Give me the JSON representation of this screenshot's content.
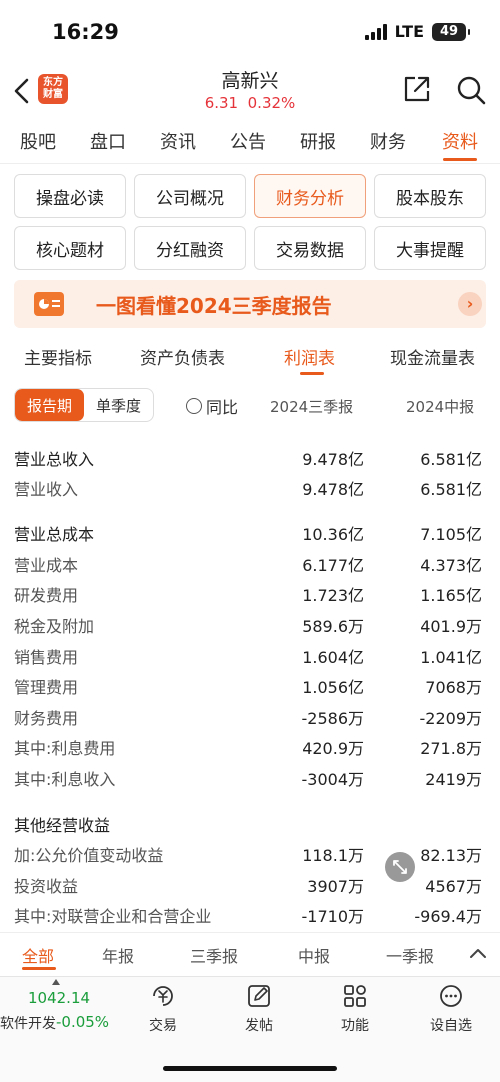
{
  "status": {
    "time": "16:29",
    "network": "LTE",
    "battery": "49"
  },
  "nav": {
    "logo_text": "东方财富",
    "stock_name": "高新兴",
    "price": "6.31",
    "change_pct": "0.32%"
  },
  "main_tabs": [
    "股吧",
    "盘口",
    "资讯",
    "公告",
    "研报",
    "财务",
    "资料"
  ],
  "main_tab_active": "资料",
  "grid_buttons": [
    "操盘必读",
    "公司概况",
    "财务分析",
    "股本股东",
    "核心题材",
    "分红融资",
    "交易数据",
    "大事提醒"
  ],
  "grid_active": "财务分析",
  "banner": {
    "text": "一图看懂2024三季度报告",
    "arrow": "›"
  },
  "sub_tabs": [
    "主要指标",
    "资产负债表",
    "利润表",
    "现金流量表"
  ],
  "sub_tab_active": "利润表",
  "controls": {
    "toggle_report": "报告期",
    "toggle_quarter": "单季度",
    "yoy": "同比",
    "col1": "2024三季报",
    "col2": "2024中报"
  },
  "rows": [
    {
      "label": "营业总收入",
      "v1": "9.478亿",
      "v2": "6.581亿",
      "section": true
    },
    {
      "label": "营业收入",
      "v1": "9.478亿",
      "v2": "6.581亿"
    },
    {
      "label": "营业总成本",
      "v1": "10.36亿",
      "v2": "7.105亿",
      "section": true
    },
    {
      "label": "营业成本",
      "v1": "6.177亿",
      "v2": "4.373亿"
    },
    {
      "label": "研发费用",
      "v1": "1.723亿",
      "v2": "1.165亿"
    },
    {
      "label": "税金及附加",
      "v1": "589.6万",
      "v2": "401.9万"
    },
    {
      "label": "销售费用",
      "v1": "1.604亿",
      "v2": "1.041亿"
    },
    {
      "label": "管理费用",
      "v1": "1.056亿",
      "v2": "7068万"
    },
    {
      "label": "财务费用",
      "v1": "-2586万",
      "v2": "-2209万"
    },
    {
      "label": "其中:利息费用",
      "v1": "420.9万",
      "v2": "271.8万"
    },
    {
      "label": "其中:利息收入",
      "v1": "-3004万",
      "v2": "2419万"
    },
    {
      "label": "其他经营收益",
      "v1": "",
      "v2": "",
      "section": true
    },
    {
      "label": "加:公允价值变动收益",
      "v1": "118.1万",
      "v2": "82.13万"
    },
    {
      "label": "投资收益",
      "v1": "3907万",
      "v2": "4567万"
    },
    {
      "label": "其中:对联营企业和合营企业",
      "v1": "-1710万",
      "v2": "-969.4万"
    }
  ],
  "filter_bar": [
    "全部",
    "年报",
    "三季报",
    "中报",
    "一季报"
  ],
  "filter_active": "全部",
  "bottom": {
    "index_value": "1042.14",
    "index_name": "软件开发",
    "index_change": "-0.05%",
    "items": [
      "交易",
      "发帖",
      "功能",
      "设自选"
    ]
  }
}
